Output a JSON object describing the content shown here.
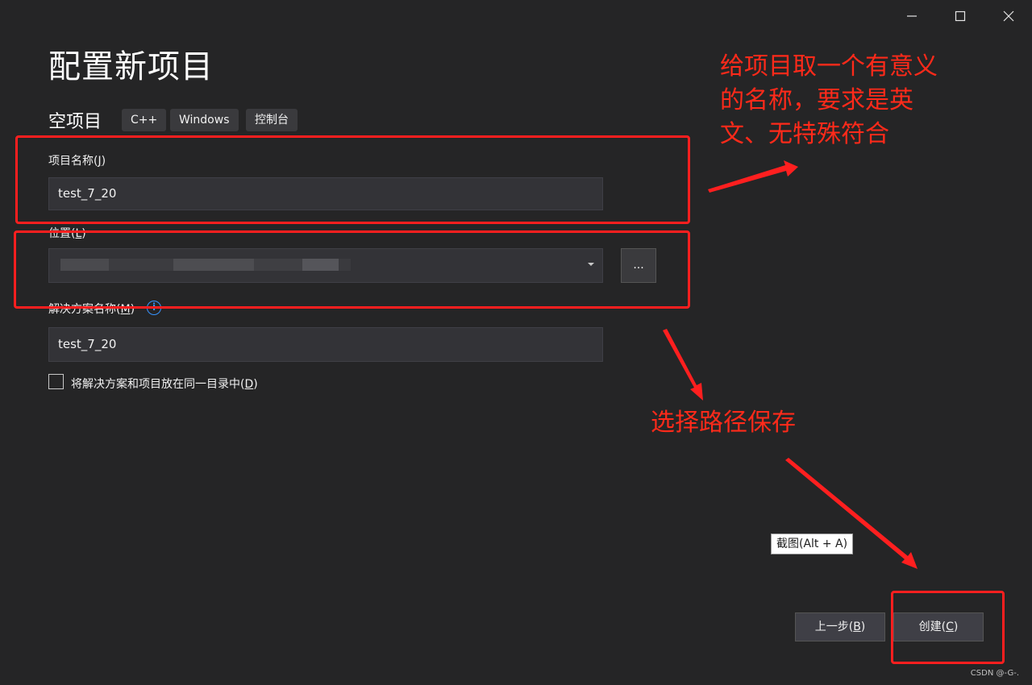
{
  "window": {
    "controls": [
      "minimize",
      "maximize",
      "close"
    ]
  },
  "page": {
    "title": "配置新项目",
    "template_name": "空项目",
    "tags": [
      "C++",
      "Windows",
      "控制台"
    ]
  },
  "form": {
    "project_name": {
      "label": "项目名称",
      "accel": "J",
      "value": "test_7_20"
    },
    "location": {
      "label": "位置",
      "accel": "L",
      "value": "",
      "browse_label": "..."
    },
    "solution_name": {
      "label": "解决方案名称",
      "accel": "M",
      "value": "test_7_20",
      "info_icon": "i"
    },
    "same_dir_checkbox": {
      "label": "将解决方案和项目放在同一目录中",
      "accel": "D",
      "checked": false
    }
  },
  "footer": {
    "back": {
      "label": "上一步",
      "accel": "B"
    },
    "create": {
      "label": "创建",
      "accel": "C"
    }
  },
  "tooltip": "截图(Alt + A)",
  "annotations": {
    "name_hint": [
      "给项目取一个有意义",
      "的名称，要求是英",
      "文、无特殊符合"
    ],
    "path_hint": "选择路径保存",
    "color": "#ff1f1f"
  },
  "watermark": "CSDN @-G-."
}
